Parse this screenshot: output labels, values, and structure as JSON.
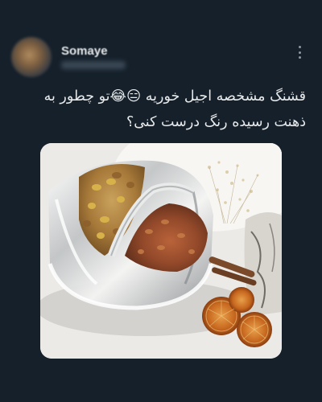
{
  "tweet": {
    "author": {
      "display_name": "Somaye",
      "avatar": "profile-photo"
    },
    "more_icon": "more-horizontal-icon",
    "text_lines": [
      "قشنگ مشخصه اجیل خوریه 😑😂تو چطور به",
      "ذهنت رسیده رنگ درست کنی؟"
    ],
    "media": {
      "kind": "photo",
      "subject": "glass bowl of nuts with dried orange slices"
    }
  },
  "colors": {
    "background": "#15202b",
    "text": "#e7e9ea",
    "muted": "#8b98a5"
  }
}
